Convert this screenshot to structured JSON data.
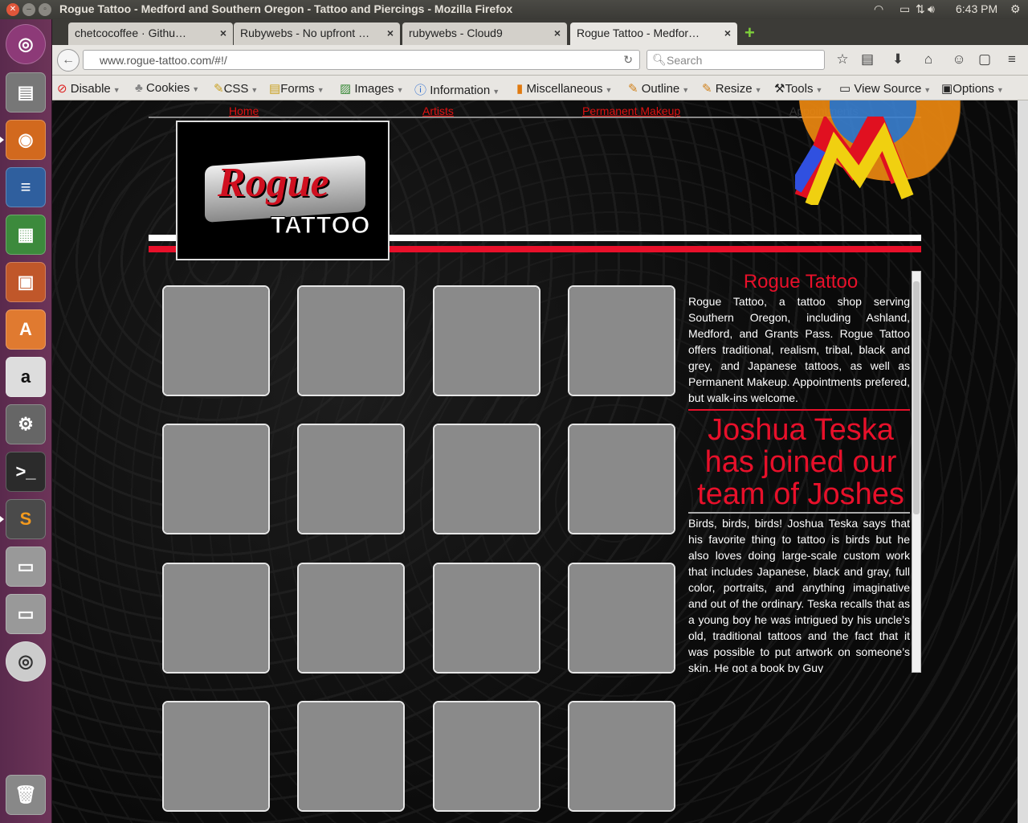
{
  "window": {
    "title": "Rogue Tattoo - Medford and Southern Oregon - Tattoo and Piercings - Mozilla Firefox",
    "time": "6:43 PM"
  },
  "tabs": [
    {
      "label": "chetcocoffee · Githu…"
    },
    {
      "label": "Rubywebs - No upfront …"
    },
    {
      "label": "rubywebs - Cloud9"
    },
    {
      "label": "Rogue Tattoo - Medfor…"
    }
  ],
  "nav": {
    "url": "www.rogue-tattoo.com/#!/",
    "search_placeholder": "Search"
  },
  "devbar": [
    "Disable",
    "Cookies",
    "CSS",
    "Forms",
    "Images",
    "Information",
    "Miscellaneous",
    "Outline",
    "Resize",
    "Tools",
    "View Source",
    "Options"
  ],
  "site": {
    "menu": [
      "Home",
      "Artists",
      "Permanent Makeup",
      "Appointments"
    ],
    "logo": {
      "word1": "Rogue",
      "word2": "TATTOO"
    },
    "sidebar": {
      "title": "Rogue Tattoo",
      "intro": "Rogue Tattoo, a tattoo shop serving Southern Oregon, including Ashland, Medford, and Grants Pass. Rogue Tattoo offers traditional, realism, tribal, black and grey, and Japanese tattoos, as well as Permanent Makeup. Appointments prefered, but walk-ins welcome.",
      "headline": "Joshua Teska has joined our team of Joshes",
      "article": "Birds, birds, birds! Joshua Teska says that his favorite thing to tattoo is birds but he also loves doing large-scale custom work that includes Japanese, black and gray, full color, portraits, and anything imaginative and out of the ordinary. Teska recalls that as a young boy he was intrigued by his uncle’s old, traditional tattoos and the fact that it was possible to put artwork on someone’s skin. He got a book by Guy"
    }
  },
  "launcher": [
    "ubuntu-dash-icon",
    "files-icon",
    "firefox-icon",
    "writer-icon",
    "calc-icon",
    "impress-icon",
    "software-center-icon",
    "amazon-icon",
    "system-settings-icon",
    "terminal-icon",
    "sublime-text-icon",
    "drive-icon",
    "drive-icon",
    "dvd-icon",
    "trash-icon"
  ]
}
